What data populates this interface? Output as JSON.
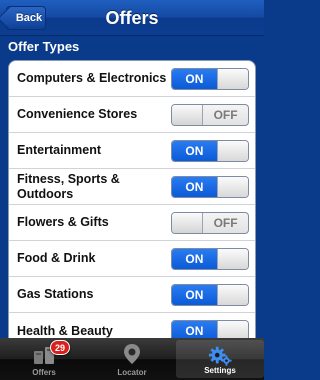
{
  "nav": {
    "back_label": "Back",
    "title": "Offers"
  },
  "section": {
    "title": "Offer Types"
  },
  "offer_types": [
    {
      "label": "Computers & Electronics",
      "state": "ON"
    },
    {
      "label": "Convenience Stores",
      "state": "OFF"
    },
    {
      "label": "Entertainment",
      "state": "ON"
    },
    {
      "label": "Fitness, Sports & Outdoors",
      "state": "ON"
    },
    {
      "label": "Flowers & Gifts",
      "state": "OFF"
    },
    {
      "label": "Food & Drink",
      "state": "ON"
    },
    {
      "label": "Gas Stations",
      "state": "ON"
    },
    {
      "label": "Health & Beauty",
      "state": "ON"
    }
  ],
  "tabbar": {
    "tabs": [
      {
        "label": "Offers",
        "icon": "offers-icon",
        "badge": "29",
        "selected": false
      },
      {
        "label": "Locator",
        "icon": "location-pin-icon",
        "selected": false
      },
      {
        "label": "Settings",
        "icon": "gears-icon",
        "selected": true
      }
    ]
  },
  "colors": {
    "nav_blue": "#1449a3",
    "background_blue": "#0a3a8a",
    "toggle_on_blue": "#0b5ad8",
    "badge_red": "#d8201c"
  }
}
